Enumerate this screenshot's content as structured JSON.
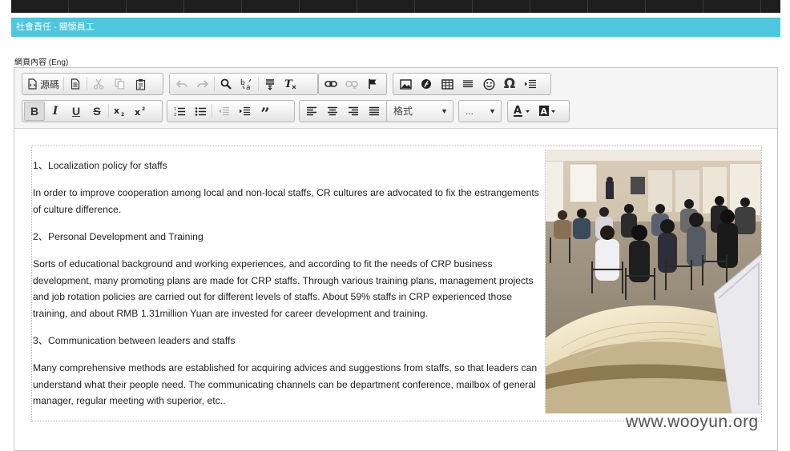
{
  "section_title": "社會責任 - 關懷員工",
  "field_label": "網頁內容 (Eng)",
  "toolbar": {
    "source_label": "源碼",
    "format_label": "格式",
    "size_label": "..."
  },
  "content": {
    "p1": "1、Localization policy for staffs",
    "p2": "In order to improve cooperation among local and non-local staffs, CR cultures are advocated to fix the estrangements of culture difference.",
    "p3": "2、Personal Development and Training",
    "p4": "Sorts of educational background and working experiences, and according to fit the needs of CRP business development, many promoting plans are made for CRP staffs. Through various training plans, management projects and job rotation policies are carried out for different levels of staffs. About 59% staffs in CRP experienced those training, and about RMB 1.31million Yuan are invested for career development and training.",
    "p5": "3、Communication between leaders and staffs",
    "p6": "Many comprehensive methods are established for acquiring advices and suggestions from staffs, so that leaders can understand what their people need. The communicating channels can be department conference, mailbox of general manager, regular meeting with superior, etc.."
  },
  "watermark": "www.wooyun.org"
}
